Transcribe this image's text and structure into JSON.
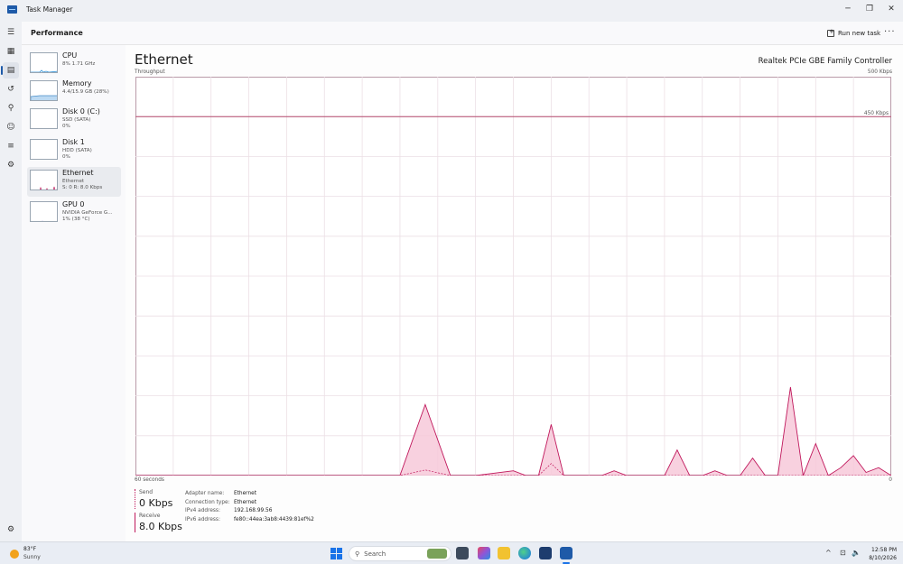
{
  "window": {
    "title": "Task Manager",
    "minimize_glyph": "─",
    "maximize_glyph": "❐",
    "close_glyph": "✕"
  },
  "header": {
    "title": "Performance",
    "run_new_task": "Run new task",
    "more": "···"
  },
  "rail": {
    "items": [
      {
        "name": "hamburger-icon",
        "glyph": "☰"
      },
      {
        "name": "processes-icon",
        "glyph": "▦"
      },
      {
        "name": "performance-icon",
        "glyph": "▤",
        "active": true
      },
      {
        "name": "app-history-icon",
        "glyph": "↺"
      },
      {
        "name": "startup-apps-icon",
        "glyph": "⚲"
      },
      {
        "name": "users-icon",
        "glyph": "☺"
      },
      {
        "name": "details-icon",
        "glyph": "≡"
      },
      {
        "name": "services-icon",
        "glyph": "⚙"
      }
    ],
    "settings_glyph": "⚙"
  },
  "devices": [
    {
      "name": "CPU",
      "sub1": "8% 1.71 GHz",
      "sub2": ""
    },
    {
      "name": "Memory",
      "sub1": "4.4/15.9 GB (28%)",
      "sub2": ""
    },
    {
      "name": "Disk 0 (C:)",
      "sub1": "SSD (SATA)",
      "sub2": "0%"
    },
    {
      "name": "Disk 1",
      "sub1": "HDD (SATA)",
      "sub2": "0%"
    },
    {
      "name": "Ethernet",
      "sub1": "Ethernet",
      "sub2": "S: 0 R: 8.0 Kbps",
      "active": true
    },
    {
      "name": "GPU 0",
      "sub1": "NVIDIA GeForce G...",
      "sub2": "1% (38 °C)"
    }
  ],
  "main": {
    "title": "Ethernet",
    "adapter_title": "Realtek PCIe GBE Family Controller",
    "throughput_label": "Throughput",
    "y_max_label": "500 Kbps",
    "x_left_label": "60 seconds",
    "x_right_label": "0",
    "send_label": "Send",
    "send_value": "0 Kbps",
    "receive_label": "Receive",
    "receive_value": "8.0 Kbps",
    "details": [
      {
        "k": "Adapter name:",
        "v": "Ethernet"
      },
      {
        "k": "Connection type:",
        "v": "Ethernet"
      },
      {
        "k": "IPv4 address:",
        "v": "192.168.99.56"
      },
      {
        "k": "IPv6 address:",
        "v": "fe80::44ea:3ab8:4439:81ef%2"
      }
    ]
  },
  "chart_data": {
    "type": "area",
    "title": "Throughput",
    "x_range": [
      60,
      0
    ],
    "ylim": [
      0,
      500
    ],
    "x_labels": [
      "60 seconds",
      "0"
    ],
    "y_labels": [
      "500 Kbps"
    ],
    "reference_line": {
      "value": 450,
      "label": "450 Kbps"
    },
    "grid": true,
    "series": [
      {
        "name": "Receive",
        "x": [
          60,
          39,
          37,
          35,
          33,
          30,
          29,
          28,
          27,
          26,
          25,
          23,
          22,
          21,
          19,
          18,
          17,
          16,
          15,
          14,
          13,
          12,
          11,
          10,
          9,
          8,
          7,
          6,
          5,
          4,
          3,
          2,
          1,
          0
        ],
        "values": [
          0,
          0,
          89,
          0,
          0,
          6,
          0,
          0,
          64,
          0,
          0,
          0,
          6,
          0,
          0,
          0,
          32,
          0,
          0,
          6,
          0,
          0,
          22,
          0,
          0,
          111,
          0,
          40,
          0,
          10,
          25,
          4,
          10,
          0
        ]
      },
      {
        "name": "Send",
        "x": [
          60,
          39,
          37,
          35,
          28,
          27,
          26,
          0
        ],
        "values": [
          0,
          0,
          7,
          0,
          0,
          15,
          0,
          0
        ]
      }
    ]
  },
  "taskbar": {
    "temp": "83°F",
    "condition": "Sunny",
    "search": "Search",
    "time": "12:58 PM",
    "date": "8/10/2026",
    "tray_up": "^",
    "tray_net": "⊡",
    "tray_vol": "🔈"
  }
}
